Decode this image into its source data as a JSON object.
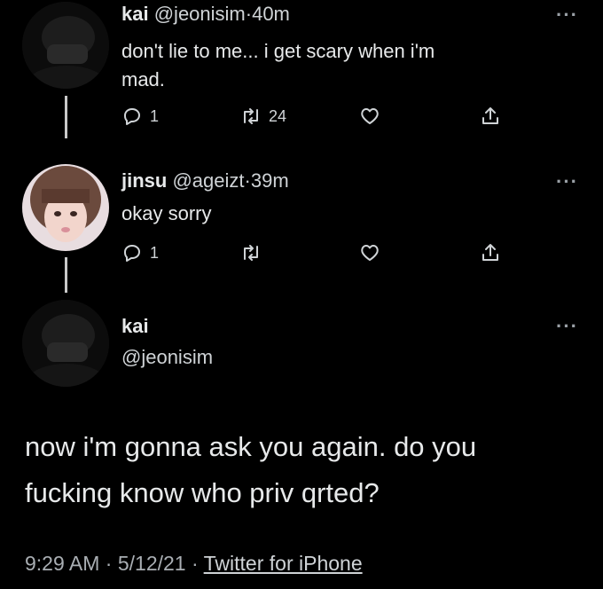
{
  "tweet1": {
    "name": "kai",
    "handle": "@jeonisim",
    "sep": "·",
    "time": "40m",
    "text_line1": "don't lie to me... i get scary when i'm",
    "text_line2": "mad.",
    "reply_count": "1",
    "retweet_count": "24",
    "more": "···"
  },
  "tweet2": {
    "name": "jinsu",
    "handle": "@ageizt",
    "sep": "·",
    "time": "39m",
    "text": "okay sorry",
    "reply_count": "1",
    "more": "···"
  },
  "main": {
    "name": "kai",
    "handle": "@jeonisim",
    "more": "···",
    "text_line1": "now i'm gonna ask you again. do you",
    "text_line2": "fucking know who priv qrted?",
    "time": "9:29 AM",
    "sep1": "·",
    "date": "5/12/21",
    "sep2": "·",
    "source": "Twitter for iPhone"
  },
  "icons": [
    "reply-icon",
    "retweet-icon",
    "like-icon",
    "share-icon",
    "more-icon"
  ]
}
